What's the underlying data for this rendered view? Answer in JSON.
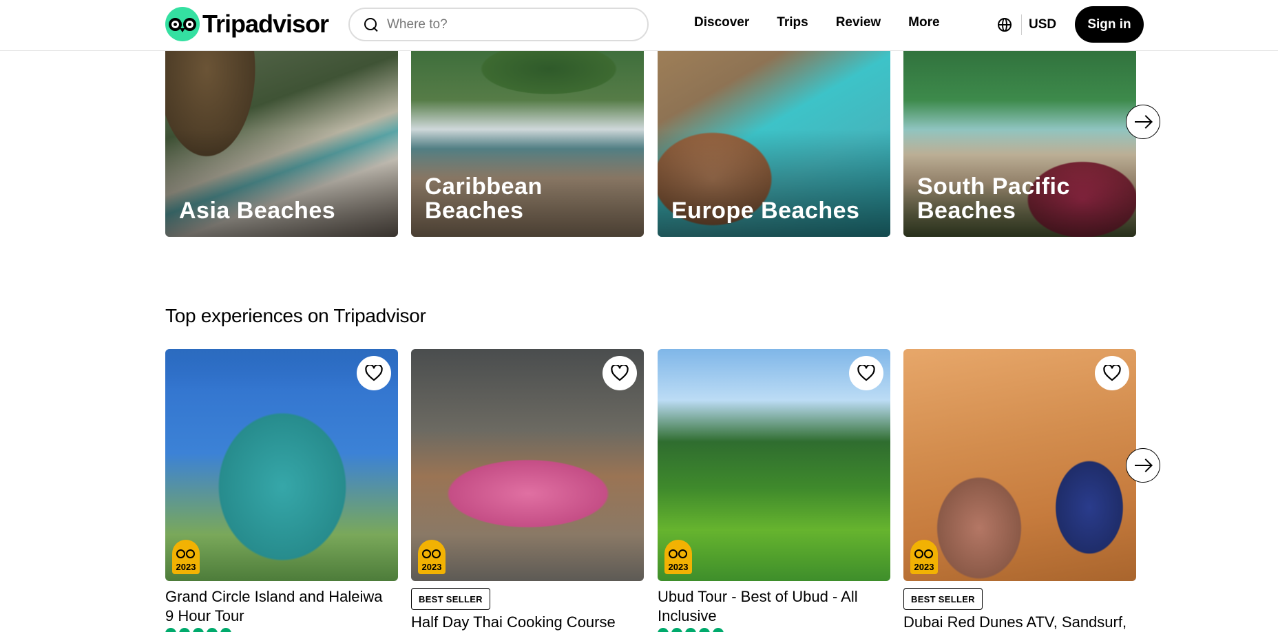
{
  "header": {
    "logo_text": "Tripadvisor",
    "search_placeholder": "Where to?",
    "nav": [
      "Discover",
      "Trips",
      "Review",
      "More"
    ],
    "currency": "USD",
    "sign_in": "Sign in"
  },
  "beaches": [
    {
      "label": "Asia Beaches"
    },
    {
      "label": "Caribbean Beaches"
    },
    {
      "label": "Europe Beaches"
    },
    {
      "label": "South Pacific Beaches"
    }
  ],
  "experiences_section": {
    "title": "Top experiences on Tripadvisor"
  },
  "experiences": [
    {
      "title": "Grand Circle Island and Haleiwa 9 Hour Tour",
      "award_year": "2023",
      "badge": ""
    },
    {
      "title": "Half Day Thai Cooking Course",
      "award_year": "2023",
      "badge": "BEST SELLER"
    },
    {
      "title": "Ubud Tour - Best of Ubud - All Inclusive",
      "award_year": "2023",
      "badge": ""
    },
    {
      "title": "Dubai Red Dunes ATV, Sandsurf,",
      "award_year": "2023",
      "badge": "BEST SELLER"
    }
  ],
  "colors": {
    "brand_green": "#34e0a1",
    "rating_green": "#00aa6c",
    "award_gold": "#f2b203",
    "sign_in_bg": "#000000"
  }
}
